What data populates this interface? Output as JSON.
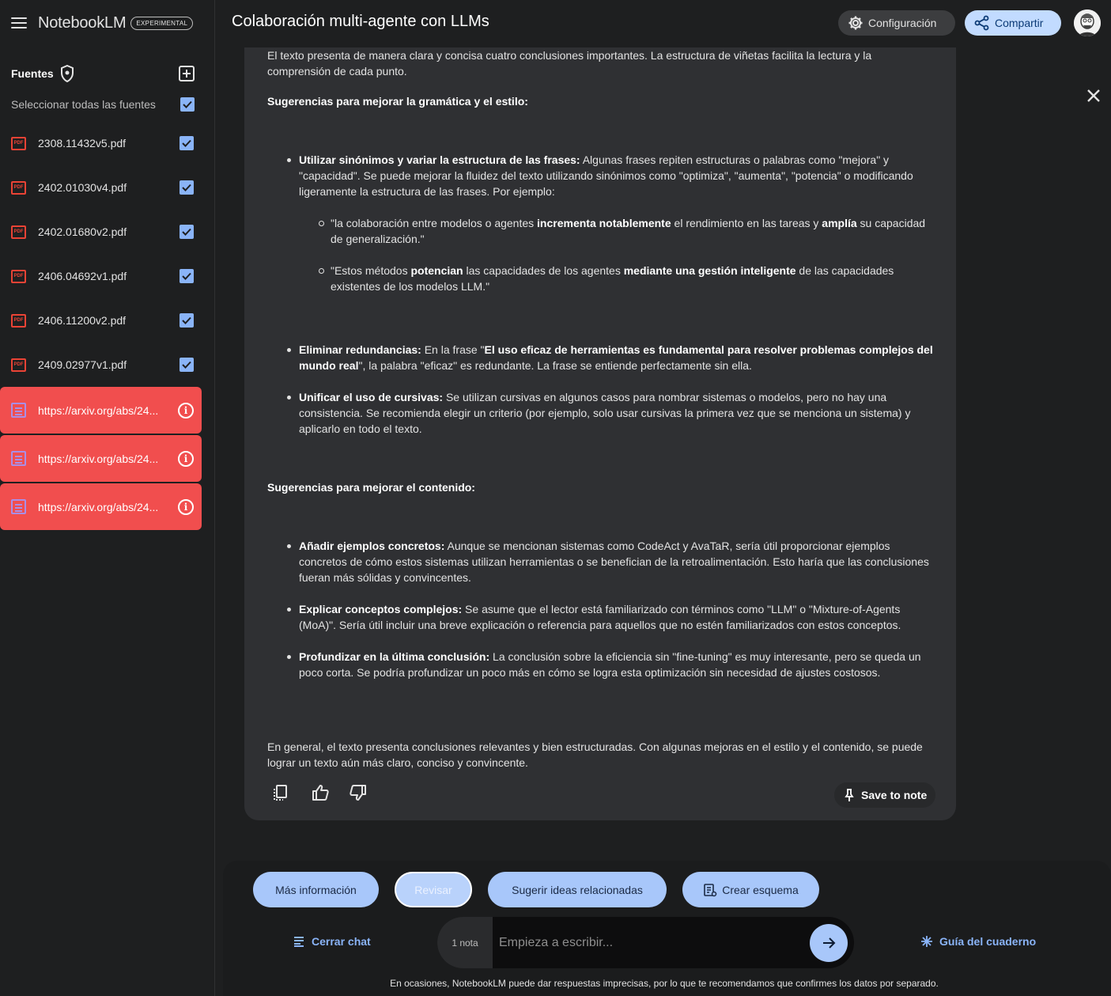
{
  "app": {
    "brand_name": "NotebookLM",
    "brand_badge": "EXPERIMENTAL",
    "notebook_title": "Colaboración multi-agente con LLMs"
  },
  "header": {
    "settings_label": "Configuración",
    "share_label": "Compartir"
  },
  "sidebar": {
    "sources_title": "Fuentes",
    "select_all_label": "Seleccionar todas las fuentes",
    "files": [
      {
        "name": "2308.11432v5.pdf",
        "checked": true
      },
      {
        "name": "2402.01030v4.pdf",
        "checked": true
      },
      {
        "name": "2402.01680v2.pdf",
        "checked": true
      },
      {
        "name": "2406.04692v1.pdf",
        "checked": true
      },
      {
        "name": "2406.11200v2.pdf",
        "checked": true
      },
      {
        "name": "2409.02977v1.pdf",
        "checked": true
      }
    ],
    "links": [
      {
        "name": "https://arxiv.org/abs/24..."
      },
      {
        "name": "https://arxiv.org/abs/24..."
      },
      {
        "name": "https://arxiv.org/abs/24..."
      }
    ],
    "pdf_icon_text": "PDF"
  },
  "response": {
    "intro": "El texto presenta de manera clara y concisa cuatro conclusiones importantes. La estructura de viñetas facilita la lectura y la comprensión de cada punto.",
    "heading_style": "Sugerencias para mejorar la gramática y el estilo:",
    "b1": {
      "bold": "Utilizar sinónimos y variar la estructura de las frases:",
      "text": " Algunas frases repiten estructuras o palabras como \"mejora\" y \"capacidad\". Se puede mejorar la fluidez del texto utilizando sinónimos como \"optimiza\", \"aumenta\", \"potencia\" o modificando ligeramente la estructura de las frases. Por ejemplo:"
    },
    "s1": {
      "t1": "\"la colaboración entre modelos o agentes ",
      "b1": "incrementa notablemente",
      "t2": " el rendimiento en las tareas y ",
      "b2": "amplía",
      "t3": " su capacidad de generalización.\""
    },
    "s2": {
      "t1": "\"Estos métodos ",
      "b1": "potencian",
      "t2": " las capacidades de los agentes ",
      "b2": "mediante una gestión inteligente",
      "t3": " de las capacidades existentes de los modelos LLM.\""
    },
    "b2": {
      "bold": "Eliminar redundancias:",
      "t1": "  En la frase \"",
      "bold2": "El uso eficaz de herramientas es fundamental para resolver problemas complejos del mundo real",
      "t2": "\",  la palabra \"eficaz\" es redundante. La frase se entiende perfectamente sin ella."
    },
    "b3": {
      "bold": "Unificar el uso de cursivas:",
      "text": "  Se utilizan cursivas en algunos casos para nombrar sistemas o modelos, pero no hay una consistencia. Se recomienda elegir un criterio (por ejemplo, solo usar cursivas la primera vez que se menciona un sistema) y aplicarlo en todo el texto."
    },
    "heading_content": "Sugerencias para mejorar el contenido:",
    "b4": {
      "bold": "Añadir ejemplos concretos:",
      "text": "  Aunque se mencionan sistemas como CodeAct y AvaTaR, sería útil proporcionar ejemplos concretos de cómo estos sistemas utilizan herramientas o se benefician de la retroalimentación. Esto haría que las conclusiones fueran más sólidas y convincentes."
    },
    "b5": {
      "bold": "Explicar conceptos complejos:",
      "text": " Se asume que el lector está familiarizado con términos como \"LLM\" o \"Mixture-of-Agents (MoA)\". Sería útil incluir una breve explicación o referencia para aquellos que no estén familiarizados con estos conceptos."
    },
    "b6": {
      "bold": "Profundizar en la última conclusión:",
      "text": "  La conclusión sobre la eficiencia sin \"fine-tuning\" es muy interesante, pero se queda un poco corta. Se podría profundizar un poco más en cómo se logra esta optimización sin necesidad de ajustes costosos."
    },
    "final": "En general, el texto presenta conclusiones relevantes y bien estructuradas. Con algunas mejoras en el estilo y el contenido,  se puede lograr un texto aún más claro, conciso y convincente.",
    "save_to_note_label": "Save to note"
  },
  "suggestions": {
    "chip1": "Más información",
    "chip2": "Revisar",
    "chip3": "Sugerir ideas relacionadas",
    "chip4": "Crear esquema"
  },
  "chat": {
    "close_chat_label": "Cerrar chat",
    "note_count": "1 nota",
    "placeholder": "Empieza a escribir...",
    "guide_label": "Guía del cuaderno"
  },
  "footer": {
    "disclaimer": "En ocasiones, NotebookLM puede dar respuestas imprecisas, por lo que te recomendamos que confirmes los datos por separado."
  },
  "colors": {
    "accent_blue": "#a8c7fa",
    "link_highlight": "#f14e4e",
    "checkbox": "#8ab4f8"
  }
}
